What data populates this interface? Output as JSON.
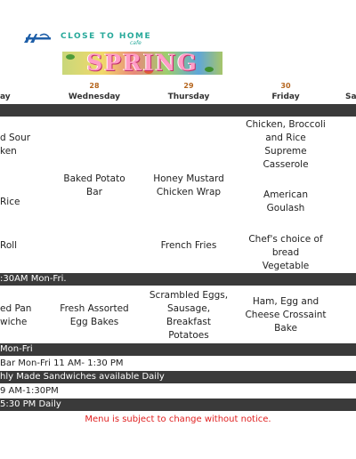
{
  "logo": {
    "title": "CLOSE TO HOME",
    "subtitle": "cafe",
    "banner_word": "SPRING"
  },
  "headers": {
    "tue": {
      "num": "",
      "name": "ay"
    },
    "wed": {
      "num": "28",
      "name": "Wednesday"
    },
    "thu": {
      "num": "29",
      "name": "Thursday"
    },
    "fri": {
      "num": "30",
      "name": "Friday"
    },
    "sat": {
      "num": "",
      "name": "Sa"
    }
  },
  "lunch": {
    "tue_1": "d Sour\nken",
    "tue_2": "Rice",
    "tue_3": "Roll",
    "wed": "Baked Potato\nBar",
    "thu_1": "Honey Mustard\nChicken Wrap",
    "thu_2": "French Fries",
    "fri_1": "Chicken, Broccoli\nand Rice\nSupreme\nCasserole",
    "fri_2": "American\nGoulash",
    "fri_3": "Chef's choice of\nbread\nVegetable"
  },
  "bars": {
    "hot_hours": ":30AM Mon-Fri.",
    "breakfast_hours": "Mon-Fri",
    "salad_bar": " Bar Mon-Fri 11 AM- 1:30 PM",
    "sandwiches": "hly Made Sandwiches available Daily",
    "grill": "9 AM-1:30PM",
    "daily": "5:30 PM Daily"
  },
  "breakfast": {
    "tue": "ed Pan\nwiche",
    "wed": "Fresh Assorted\nEgg Bakes",
    "thu": "Scrambled Eggs,\nSausage,\nBreakfast\nPotatoes",
    "fri": "Ham, Egg and\nCheese Crossaint\nBake"
  },
  "note": "Menu is subject to change without notice.",
  "colors": {
    "bar": "#3a3a3a",
    "teal": "#27a99a",
    "note": "#e02020",
    "daynum": "#b5651d"
  }
}
